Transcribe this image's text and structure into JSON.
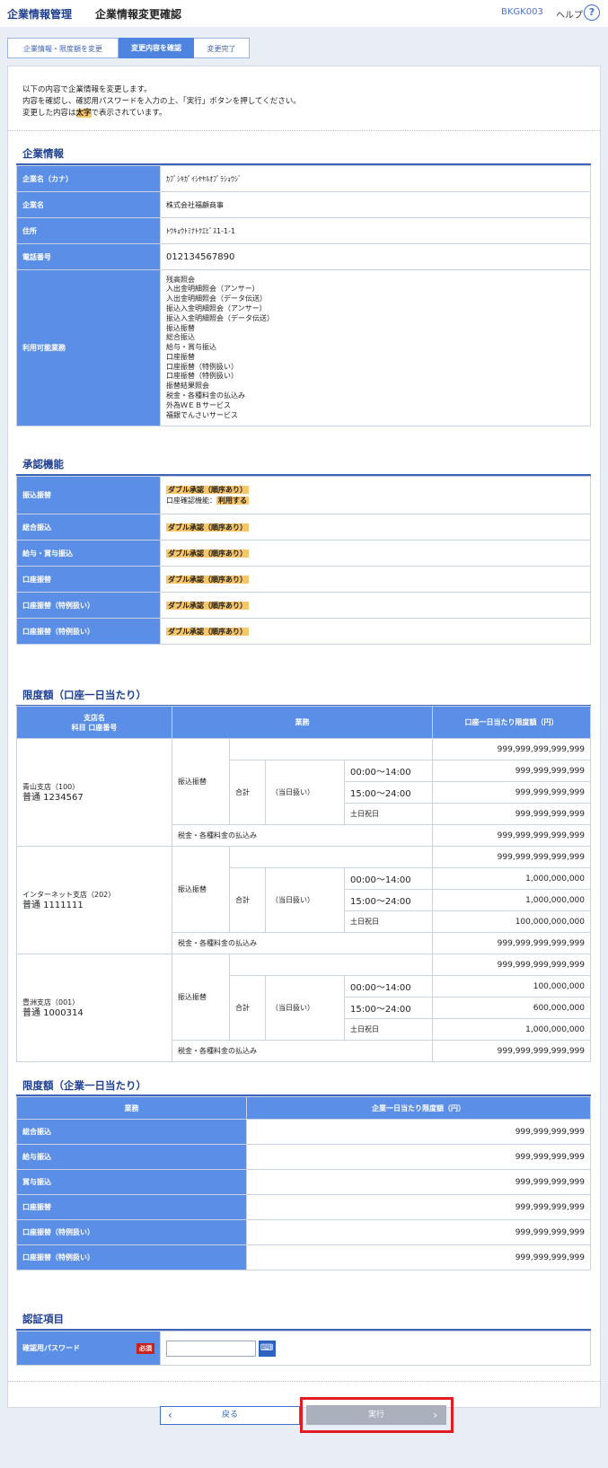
{
  "header": {
    "category": "企業情報管理",
    "title": "企業情報変更確認",
    "screen_code": "BKGK003",
    "help_label": "ヘルプ",
    "help_icon": "?"
  },
  "steps": [
    "企業情報・限度額を変更",
    "変更内容を確認",
    "変更完了"
  ],
  "intro": {
    "line1": "以下の内容で企業情報を変更します。",
    "line2": "内容を確認し、確認用パスワードを入力の上、「実行」ボタンを押してください。",
    "line3_pre": "変更した内容は",
    "line3_mark": "太字",
    "line3_post": "で表示されています。"
  },
  "company": {
    "title": "企業情報",
    "rows": [
      {
        "label": "企業名（カナ）",
        "value": "ｶﾌﾞｼｷｶﾞｲｼﾔﾔﾙｵﾌﾞﾗｼｮｳｼﾞ"
      },
      {
        "label": "企業名",
        "value": "株式会社福顧商事"
      },
      {
        "label": "住所",
        "value": "ﾄｳｷｮｳﾄﾐﾅﾄｸｴﾋﾞｽ1-1-1"
      },
      {
        "label": "電話番号",
        "value": "012134567890"
      }
    ],
    "services_label": "利用可能業務",
    "services": [
      "残高照会",
      "入出金明細照会（アンサー）",
      "入出金明細照会（データ伝送）",
      "振込入金明細照会（アンサー）",
      "振込入金明細照会（データ伝送）",
      "振込振替",
      "総合振込",
      "給与・賞与振込",
      "口座振替",
      "口座振替（特例扱い）",
      "口座振替（特例扱い）",
      "振替結果照会",
      "税金・各種料金の払込み",
      "外為ＷＥＢサービス",
      "福銀でんさいサービス"
    ]
  },
  "approval": {
    "title": "承認機能",
    "rows": [
      {
        "label": "振込振替",
        "value": "ダブル承認（順序あり）",
        "sub_pre": "口座確認機能：",
        "sub_mark": "利用する"
      },
      {
        "label": "総合振込",
        "value": "ダブル承認（順序あり）"
      },
      {
        "label": "給与・賞与振込",
        "value": "ダブル承認（順序あり）"
      },
      {
        "label": "口座振替",
        "value": "ダブル承認（順序あり）"
      },
      {
        "label": "口座振替（特例扱い）",
        "value": "ダブル承認（順序あり）"
      },
      {
        "label": "口座振替（特例扱い）",
        "value": "ダブル承認（順序あり）"
      }
    ]
  },
  "limit_account": {
    "title": "限度額（口座一日当たり）",
    "col_branch_1": "支店名",
    "col_branch_2": "科目 口座番号",
    "col_service": "業務",
    "col_limit": "口座一日当たり限度額（円）",
    "transfer_label": "振込振替",
    "total_label": "合計",
    "sameday_label": "（当日扱い）",
    "slot1": "00:00～14:00",
    "slot2": "15:00～24:00",
    "slot3": "土日祝日",
    "tax_label": "税金・各種料金の払込み",
    "accounts": [
      {
        "branch": "青山支店（100）",
        "account": "普通 1234567",
        "total": "999,999,999,999,999",
        "s1": "999,999,999,999",
        "s2": "999,999,999,999",
        "s3": "999,999,999,999",
        "tax": "999,999,999,999,999"
      },
      {
        "branch": "インターネット支店（202）",
        "account": "普通 1111111",
        "total": "999,999,999,999,999",
        "s1": "1,000,000,000",
        "s2": "1,000,000,000",
        "s3": "100,000,000,000",
        "tax": "999,999,999,999,999"
      },
      {
        "branch": "豊洲支店（001）",
        "account": "普通 1000314",
        "total": "999,999,999,999,999",
        "s1": "100,000,000",
        "s2": "600,000,000",
        "s3": "1,000,000,000",
        "tax": "999,999,999,999,999"
      }
    ]
  },
  "limit_company": {
    "title": "限度額（企業一日当たり）",
    "col_service": "業務",
    "col_limit": "企業一日当たり限度額（円）",
    "rows": [
      {
        "label": "総合振込",
        "value": "999,999,999,999"
      },
      {
        "label": "給与振込",
        "value": "999,999,999,999"
      },
      {
        "label": "賞与振込",
        "value": "999,999,999,999"
      },
      {
        "label": "口座振替",
        "value": "999,999,999,999"
      },
      {
        "label": "口座振替（特例扱い）",
        "value": "999,999,999,999"
      },
      {
        "label": "口座振替（特例扱い）",
        "value": "999,999,999,999"
      }
    ]
  },
  "auth": {
    "title": "認証項目",
    "password_label": "確認用パスワード",
    "required_badge": "必須",
    "password_value": ""
  },
  "buttons": {
    "back": "戻る",
    "execute": "実行"
  }
}
